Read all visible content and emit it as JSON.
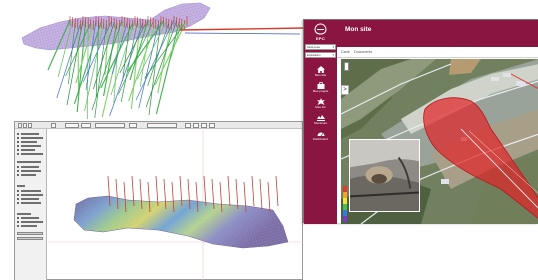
{
  "app": {
    "logo_text": "EPC",
    "title": "Mon site",
    "selects": [
      "Nettoyeuse",
      "Exploitation"
    ],
    "nav": [
      {
        "label": "Mon site",
        "icon": "home-icon"
      },
      {
        "label": "Mes projets",
        "icon": "briefcase-icon"
      },
      {
        "label": "Mes tirs",
        "icon": "blast-icon"
      },
      {
        "label": "Sismicure",
        "icon": "seismic-icon"
      },
      {
        "label": "Dashboard",
        "icon": "dashboard-icon"
      }
    ],
    "tabs": [
      "Carte",
      "Documents"
    ],
    "map_toggle": ">",
    "colors": {
      "brand": "#8a1540",
      "danger_zone": "#e0262a"
    }
  },
  "model_window": {
    "panel_labels": [
      "Paramètres",
      "Outils",
      "Affichage"
    ]
  }
}
